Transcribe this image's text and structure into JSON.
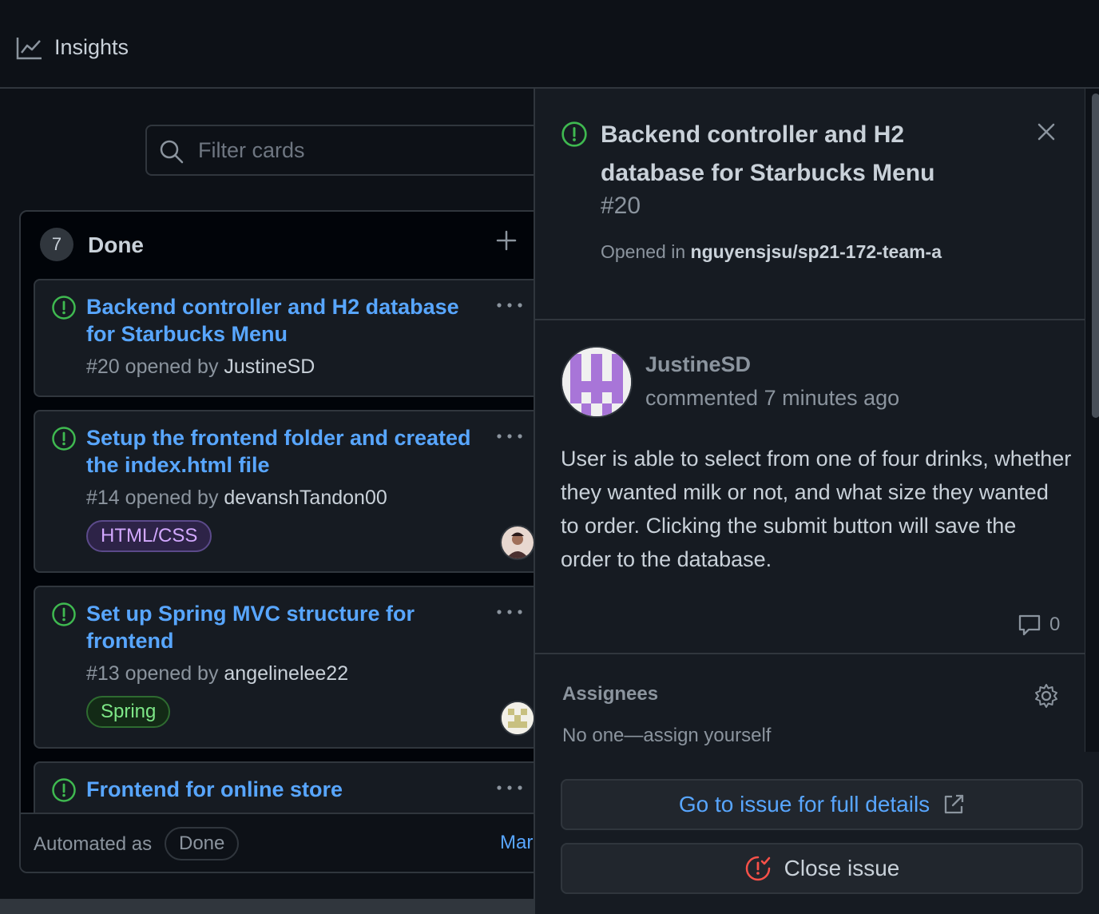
{
  "topbar": {
    "insights_label": "Insights"
  },
  "filter": {
    "placeholder": "Filter cards"
  },
  "column": {
    "count": "7",
    "title": "Done",
    "cards": [
      {
        "title": "Backend controller and H2 database for Starbucks Menu",
        "number": "#20",
        "opened_by": "opened by",
        "author": "JustineSD"
      },
      {
        "title": "Setup the frontend folder and created the index.html file",
        "number": "#14",
        "opened_by": "opened by",
        "author": "devanshTandon00",
        "label": "HTML/CSS"
      },
      {
        "title": "Set up Spring MVC structure for frontend",
        "number": "#13",
        "opened_by": "opened by",
        "author": "angelinelee22",
        "label": "Spring"
      },
      {
        "title": "Frontend for online store"
      }
    ],
    "footer": {
      "automated": "Automated as",
      "badge": "Done",
      "manage": "Mar"
    }
  },
  "panel": {
    "title": "Backend controller and H2 database for Starbucks Menu",
    "number": "#20",
    "opened_in": "Opened in",
    "repo": "nguyensjsu/sp21-172-team-a",
    "author": "JustineSD",
    "when": "commented 7 minutes ago",
    "body": "User is able to select from one of four drinks, whether they wanted milk or not, and what size they wanted to order. Clicking the submit button will save the order to the database.",
    "comment_count": "0",
    "assignees_heading": "Assignees",
    "assignees_value": "No one—assign yourself",
    "go_button": "Go to issue for full details",
    "close_button": "Close issue"
  },
  "colors": {
    "accent": "#58a6ff",
    "open_issue": "#3fb950",
    "close_icon": "#f85149",
    "label_html": "#d2a8ff",
    "label_spring": "#7ee787"
  }
}
